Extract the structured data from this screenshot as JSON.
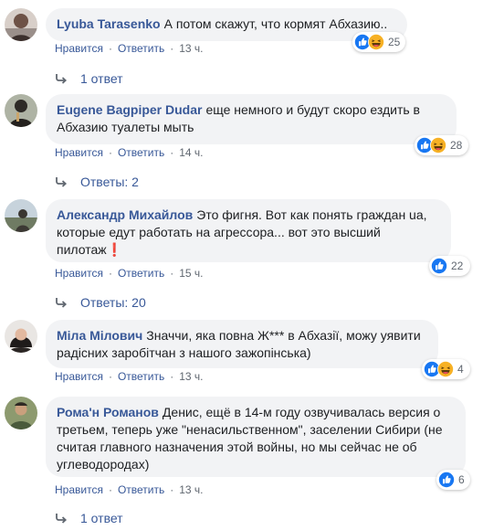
{
  "comments": [
    {
      "author": "Lyuba Tarasenko",
      "text": "А потом скажут, что кормят Абхазию..",
      "like_label": "Нравится",
      "reply_label": "Ответить",
      "time": "13 ч.",
      "reaction_count": "25",
      "reactions": [
        "like-icon",
        "haha-icon"
      ],
      "replies": "1 ответ"
    },
    {
      "author": "Eugene Bagpiper Dudar",
      "text": "еще немного и будут скоро ездить в Абхазию туалеты мыть",
      "like_label": "Нравится",
      "reply_label": "Ответить",
      "time": "14 ч.",
      "reaction_count": "28",
      "reactions": [
        "like-icon",
        "haha-icon"
      ],
      "replies": "Ответы: 2"
    },
    {
      "author": "Александр Михайлов",
      "text": "Это фигня. Вот как понять граждан ua, которые едут работать на агрессора... вот это высший пилотаж❗",
      "like_label": "Нравится",
      "reply_label": "Ответить",
      "time": "15 ч.",
      "reaction_count": "22",
      "reactions": [
        "like-icon"
      ],
      "replies": "Ответы: 20"
    },
    {
      "author": "Міла Мілович",
      "text": "Значчи, яка повна Ж*** в Абхазії, можу уявити радісних заробітчан з нашого зажопінська)",
      "like_label": "Нравится",
      "reply_label": "Ответить",
      "time": "13 ч.",
      "reaction_count": "4",
      "reactions": [
        "like-icon",
        "haha-icon"
      ],
      "replies": ""
    },
    {
      "author": "Рома'н Романов",
      "text": "Денис, ещё в 14-м году озвучивалась версия о третьем, теперь уже \"ненасильственном\", заселении Сибири (не считая главного назначения этой войны, но мы сейчас не об углеводородах)",
      "like_label": "Нравится",
      "reply_label": "Ответить",
      "time": "13 ч.",
      "reaction_count": "6",
      "reactions": [
        "like-icon"
      ],
      "replies": "1 ответ"
    }
  ],
  "colors": {
    "author": "#385898",
    "bubble": "#f2f3f5",
    "meta": "#606770",
    "like": "#1877f2",
    "haha": "#f7b125"
  }
}
